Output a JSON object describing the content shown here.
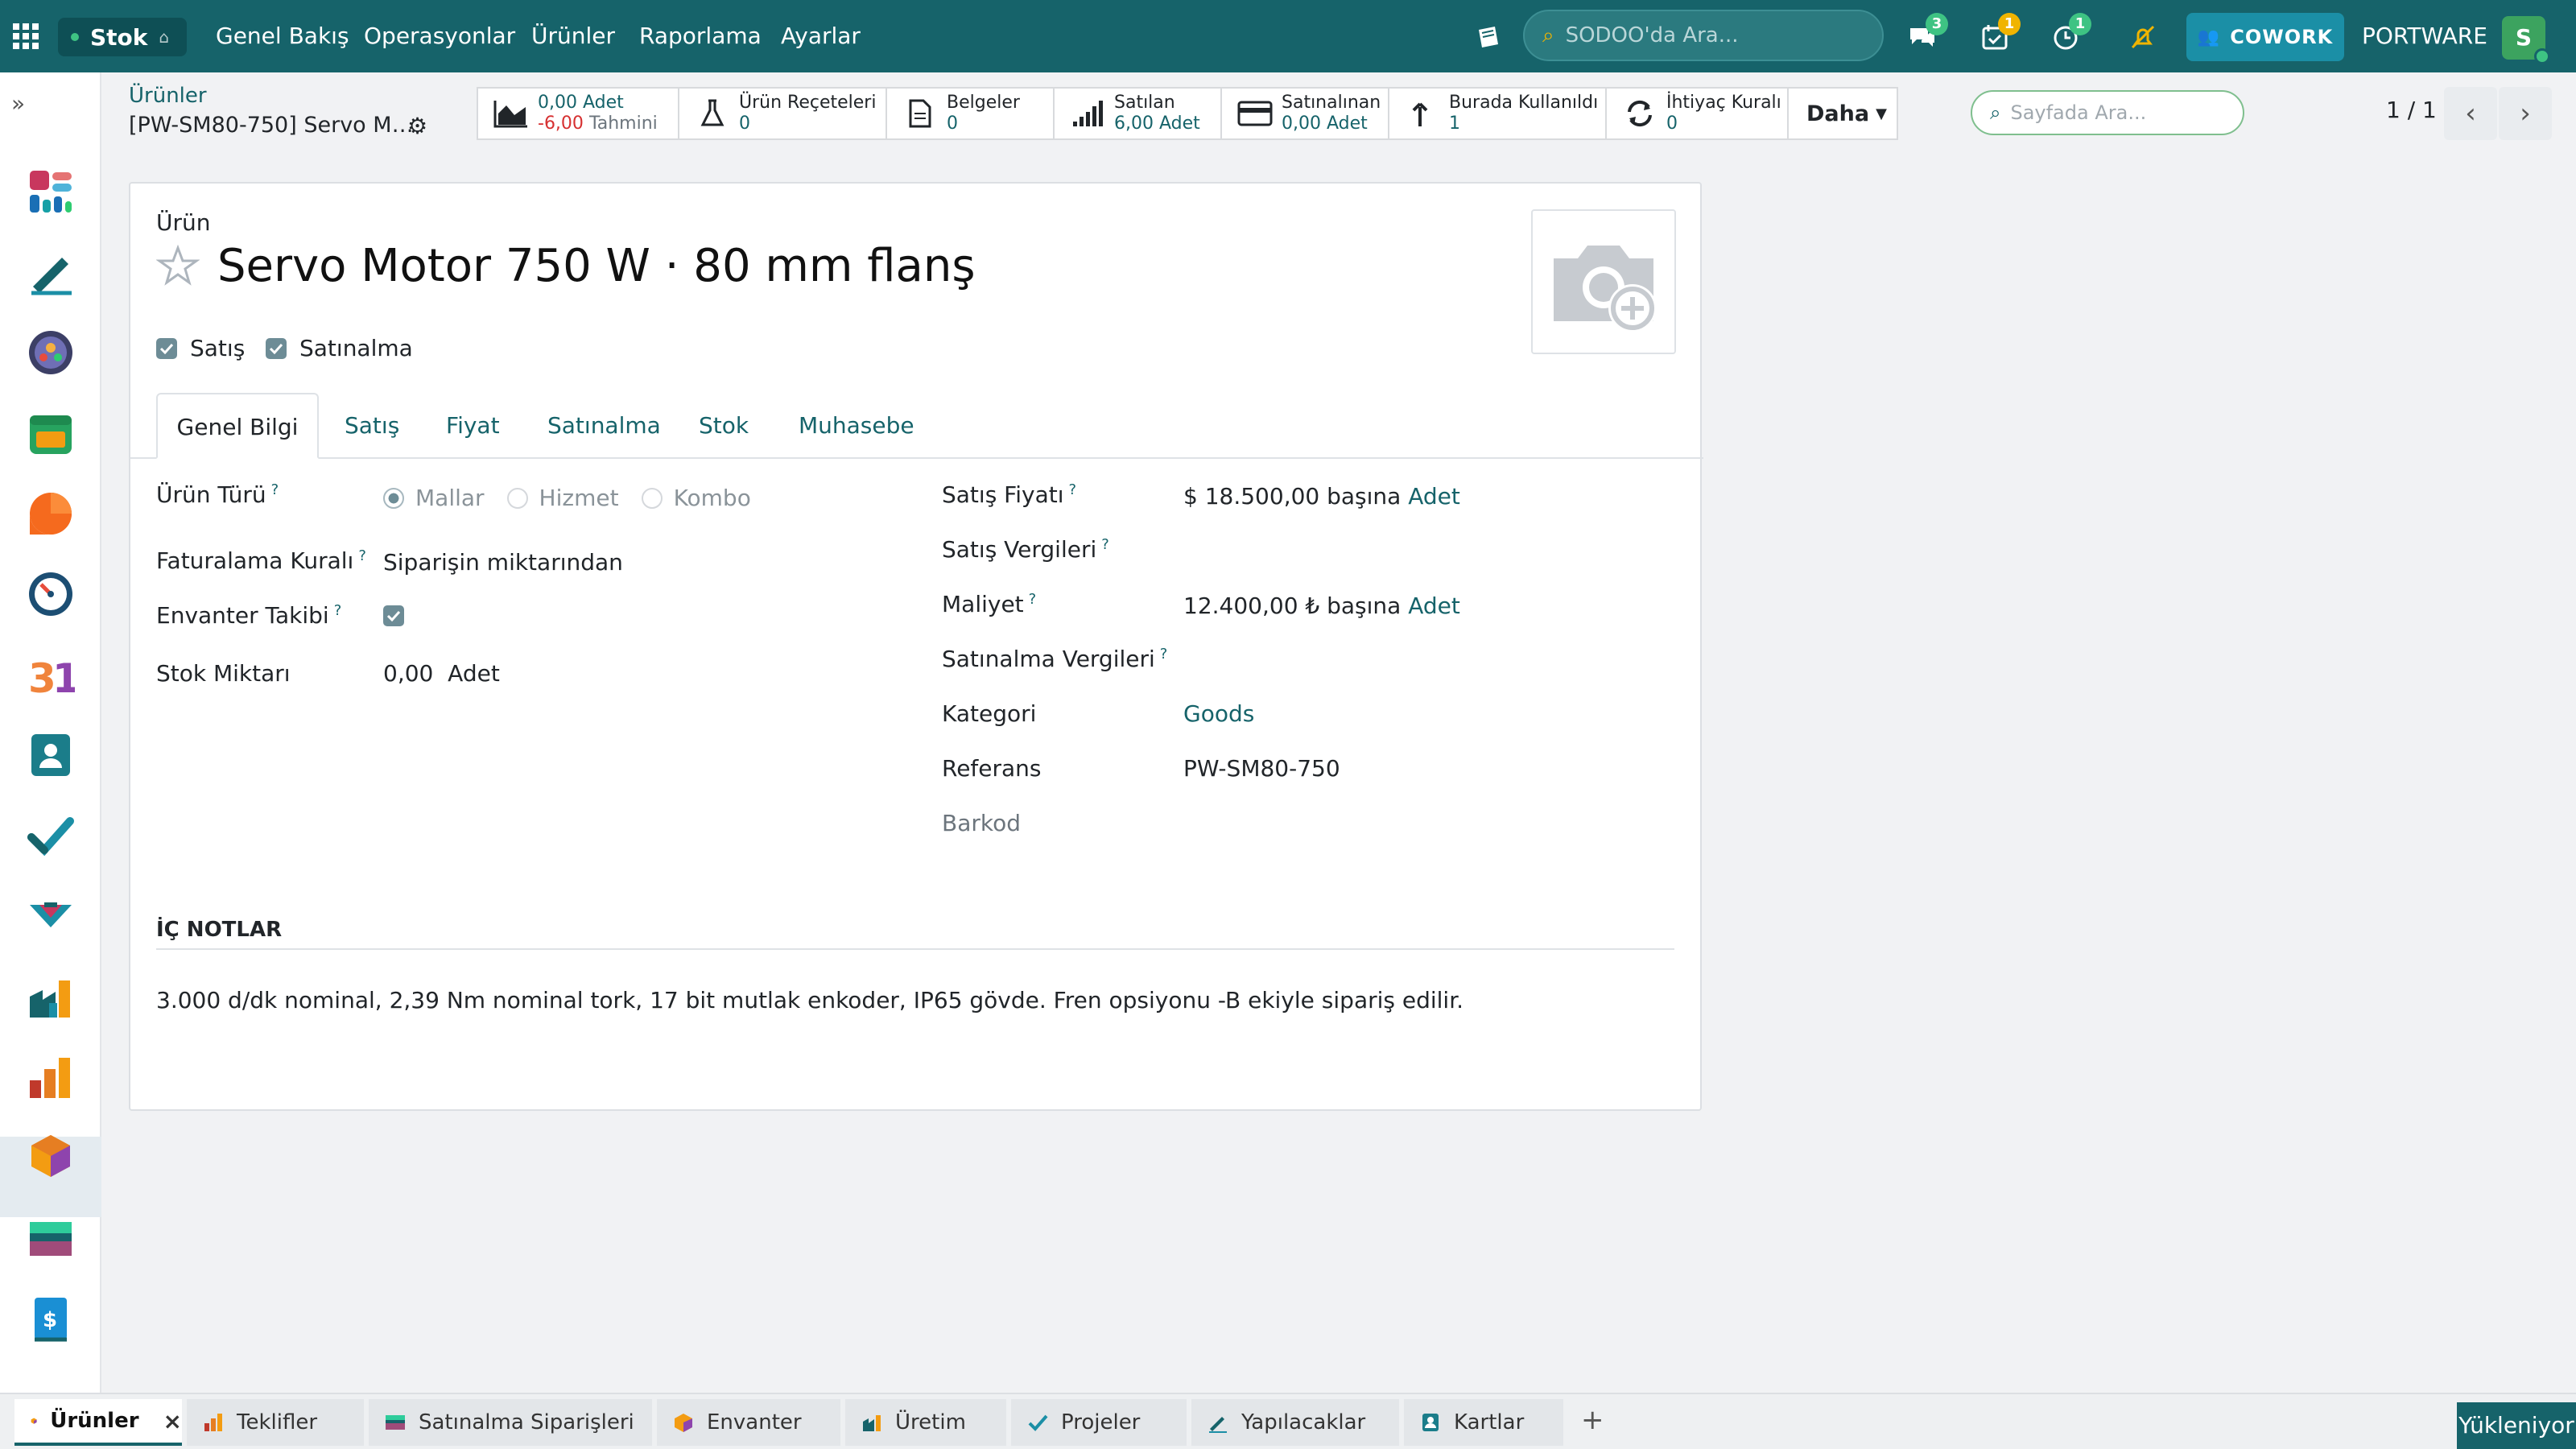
{
  "topbar": {
    "app_name": "Stok",
    "home_icon": "home-icon",
    "menu": [
      "Genel Bakış",
      "Operasyonlar",
      "Ürünler",
      "Raporlama",
      "Ayarlar"
    ],
    "search_placeholder": "SODOO'da Ara...",
    "badges": {
      "messages": "3",
      "activities": "1",
      "timesheet": "1"
    },
    "cowork_label": "COWORK",
    "company": "PORTWARE",
    "avatar_letter": "S",
    "colors": {
      "bar": "#16636a",
      "accent": "#1b8fa6",
      "badge_green": "#3ec383",
      "badge_yellow": "#f0b400"
    }
  },
  "breadcrumb": {
    "parent": "Ürünler",
    "current": "[PW-SM80-750] Servo M…"
  },
  "smart_buttons": [
    {
      "icon": "area-chart-icon",
      "line1": "0,00 Adet",
      "line2": "-6,00",
      "line2b": "Tahmini"
    },
    {
      "icon": "flask-icon",
      "line1": "Ürün Reçeteleri",
      "line2": "0"
    },
    {
      "icon": "document-icon",
      "line1": "Belgeler",
      "line2": "0"
    },
    {
      "icon": "signal-icon",
      "line1": "Satılan",
      "line2": "6,00 Adet"
    },
    {
      "icon": "credit-card-icon",
      "line1": "Satınalınan",
      "line2": "0,00 Adet"
    },
    {
      "icon": "level-up-icon",
      "line1": "Burada Kullanıldı",
      "line2": "1"
    },
    {
      "icon": "refresh-icon",
      "line1": "İhtiyaç Kuralı",
      "line2": "0"
    }
  ],
  "more_label": "Daha",
  "page_search_placeholder": "Sayfada Ara...",
  "pager": "1 / 1",
  "product": {
    "label": "Ürün",
    "name": "Servo Motor 750 W · 80 mm flanş",
    "can_sell_label": "Satış",
    "can_purchase_label": "Satınalma"
  },
  "tabs": [
    "Genel Bilgi",
    "Satış",
    "Fiyat",
    "Satınalma",
    "Stok",
    "Muhasebe"
  ],
  "general": {
    "type_label": "Ürün Türü",
    "type_options": [
      "Mallar",
      "Hizmet",
      "Kombo"
    ],
    "invoicing_label": "Faturalama Kuralı",
    "invoicing_value": "Siparişin miktarından",
    "tracking_label": "Envanter Takibi",
    "stock_label": "Stok Miktarı",
    "stock_value": "0,00",
    "stock_unit": "Adet",
    "sale_price_label": "Satış Fiyatı",
    "sale_price_value": "$ 18.500,00 başına",
    "sale_price_unit": "Adet",
    "sale_taxes_label": "Satış Vergileri",
    "cost_label": "Maliyet",
    "cost_value": "12.400,00 ₺ başına",
    "cost_unit": "Adet",
    "purchase_taxes_label": "Satınalma Vergileri",
    "category_label": "Kategori",
    "category_value": "Goods",
    "reference_label": "Referans",
    "reference_value": "PW-SM80-750",
    "barcode_label": "Barkod",
    "q": "?"
  },
  "notes": {
    "heading": "İÇ NOTLAR",
    "text": "3.000 d/dk nominal, 2,39 Nm nominal tork, 17 bit mutlak enkoder, IP65 gövde. Fren opsiyonu -B ekiyle sipariş edilir."
  },
  "dock": {
    "tabs": [
      "Ürünler",
      "Teklifler",
      "Satınalma Siparişleri",
      "Envanter",
      "Üretim",
      "Projeler",
      "Yapılacaklar",
      "Kartlar"
    ],
    "add": "+",
    "close": "×",
    "loading": "Yükleniyor"
  }
}
